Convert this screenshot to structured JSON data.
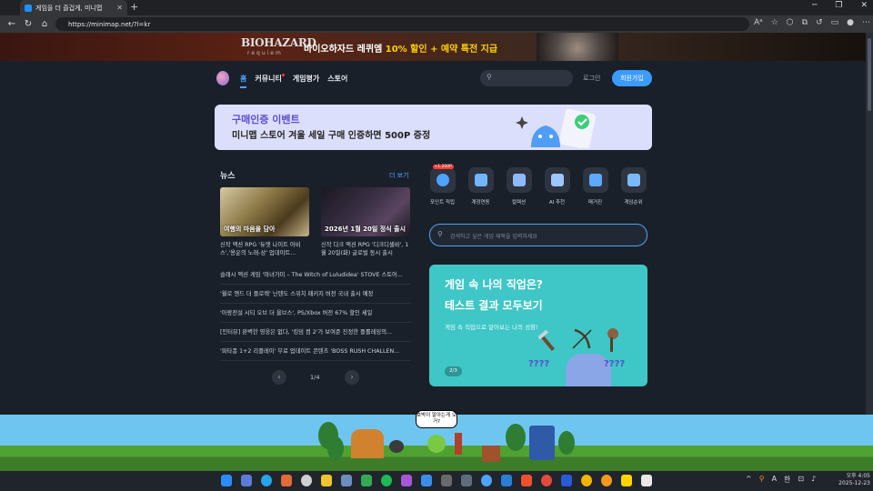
{
  "browser": {
    "tab_title": "게임을 더 즐겁게, 미니맵",
    "tab_close": "✕",
    "new_tab": "+",
    "url": "https://minimap.net/?l=kr",
    "win_min": "─",
    "win_max": "❐",
    "win_close": "✕",
    "nav_back": "←",
    "nav_reload": "↻",
    "nav_home": "⌂"
  },
  "banner": {
    "logo": "BIOHAZARD",
    "logo_sub": "requiem",
    "text": "바이오하자드 레퀴엠 ",
    "highlight": "10% 할인 + 예약 특전 지급"
  },
  "site": {
    "menu": {
      "home": "홈",
      "community": "커뮤니티",
      "review": "게임평가",
      "store": "스토어"
    },
    "search_icon": "⚲",
    "login": "로그인",
    "signup": "회원가입"
  },
  "promo": {
    "title": "구매인증 이벤트",
    "desc": "미니맵 스토어 겨울 세일 구매 인증하면 500P 증정"
  },
  "news": {
    "title": "뉴스",
    "more": "더 보기",
    "thumb1_cap": "여행의 마음을 담아",
    "thumb2_cap": "2026년 1월 20일 정식 출시",
    "cards": [
      {
        "caption": "신작 액션 RPG '듀엣 나이트 어비스','용운의 노래-상' 업데이트..."
      },
      {
        "caption": "신작 다크 액션 RPG '디크디셀바', 1월 20일(화) 글로벌 동시 출시"
      }
    ],
    "items": [
      "슬래시 액션 게임 '마녀가미 – The Witch of Luludidea' STOVE 스토어...",
      "'월로 앤드 더 플로렉' 닌텐도 스위치 패키지 버전 국내 출시 예정",
      "'아랑전설 시티 오브 더 울브스', PS/Xbox 버전 67% 할인 세일",
      "[인터뷰] 완벽한 영웅은 없다, '킹덤 컴 2'가 보여준 진정한 플롤레잉의...",
      "'파타퐁 1+2 리플레이' 무료 업데이트 콘텐츠 'BOSS RUSH CHALLEN..."
    ],
    "pager": {
      "label": "1/4",
      "prev": "‹",
      "next": "›"
    }
  },
  "quick": [
    {
      "label": "포인트 적립",
      "badge": "+1,200P"
    },
    {
      "label": "계정연동"
    },
    {
      "label": "컬렉션"
    },
    {
      "label": "AI 추천"
    },
    {
      "label": "매거진"
    },
    {
      "label": "게임순위"
    }
  ],
  "bigsearch": {
    "placeholder": "검색하고 싶은 게임 제목을 입력하세요"
  },
  "quiz": {
    "line1": "게임 속 나의 직업은?",
    "line2": "테스트 결과 모두보기",
    "sub": "게임 속 직업으로 알아보는 나의 성향!",
    "page": "2/3",
    "q1": "????",
    "q2": "????"
  },
  "desktop": {
    "bubble": "호박이 알아는게 오거?"
  },
  "tray": {
    "ime": "A",
    "lang": "한",
    "time": "오후 4:05",
    "date": "2025-12-23"
  },
  "colors": {
    "accent": "#4da3ff",
    "signup": "#3b9bff",
    "quiz": "#3fc6c6",
    "promo": "#dcdffb"
  }
}
